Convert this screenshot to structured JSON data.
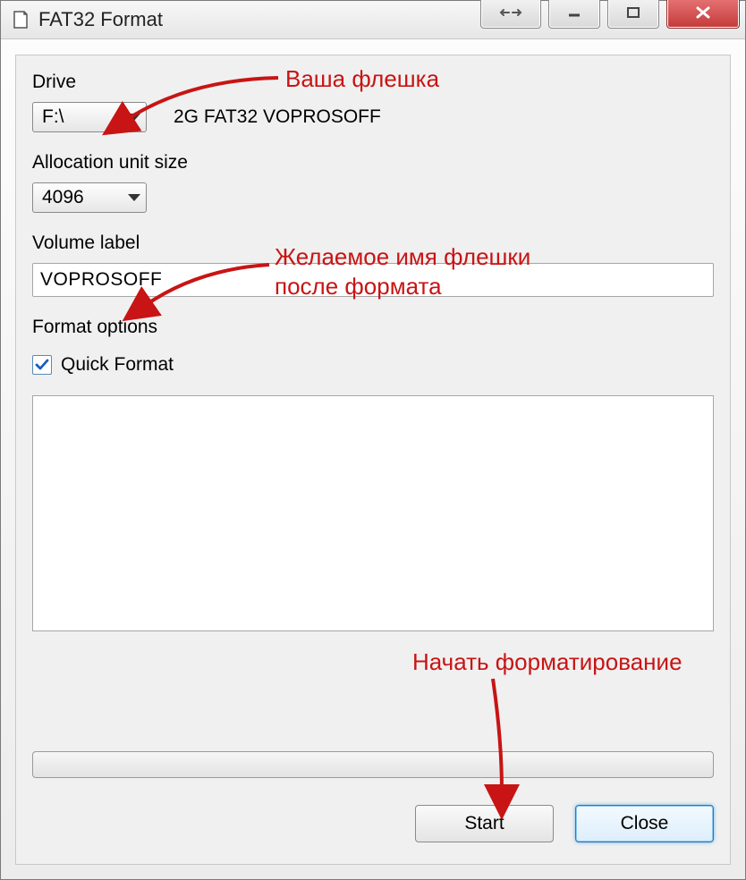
{
  "window": {
    "title": "FAT32 Format"
  },
  "labels": {
    "drive": "Drive",
    "alloc": "Allocation unit size",
    "volume": "Volume label",
    "options": "Format options",
    "quick": "Quick Format"
  },
  "drive": {
    "selected": "F:\\",
    "info": "2G FAT32 VOPROSOFF"
  },
  "alloc": {
    "selected": "4096"
  },
  "volume": {
    "value": "VOPROSOFF"
  },
  "quickFormat": {
    "checked": true
  },
  "buttons": {
    "start": "Start",
    "close": "Close"
  },
  "annotations": {
    "a1": "Ваша флешка",
    "a2_line1": "Желаемое имя флешки",
    "a2_line2": "после формата",
    "a3": "Начать форматирование"
  }
}
